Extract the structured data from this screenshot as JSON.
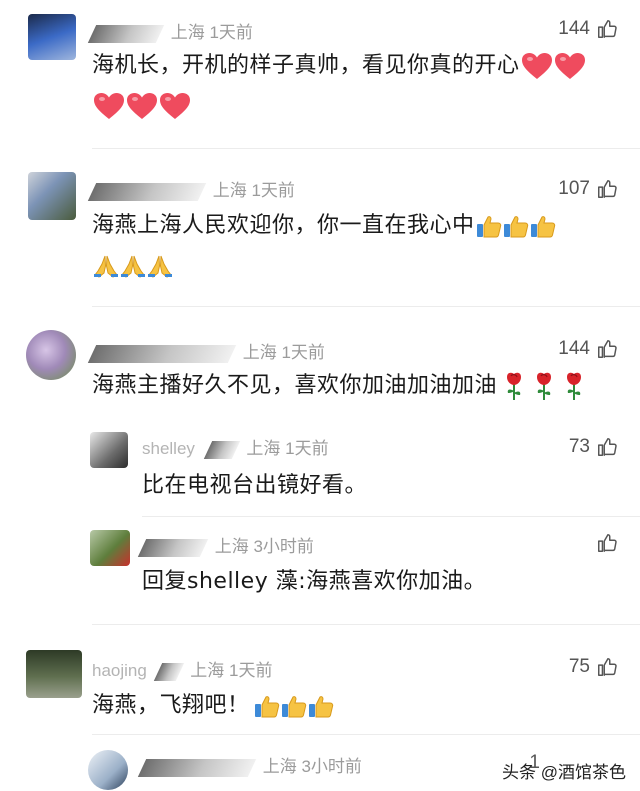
{
  "comments": [
    {
      "location": "上海",
      "time": "1天前",
      "likes": "144",
      "text": "海机长，开机的样子真帅，看见你真的开心",
      "emojis": [
        "heart",
        "heart",
        "heart",
        "heart",
        "heart"
      ]
    },
    {
      "location": "上海",
      "time": "1天前",
      "likes": "107",
      "text": "海燕上海人民欢迎你，你一直在我心中",
      "emojis": [
        "thumbs-up",
        "thumbs-up",
        "thumbs-up",
        "pray",
        "pray",
        "pray"
      ]
    },
    {
      "location": "上海",
      "time": "1天前",
      "likes": "144",
      "text": "海燕主播好久不见，喜欢你加油加油加油",
      "emojis": [
        "rose",
        "rose",
        "rose"
      ],
      "replies": [
        {
          "name_fragment": "shelley",
          "location": "上海",
          "time": "1天前",
          "likes": "73",
          "text": "比在电视台出镜好看。"
        },
        {
          "location": "上海",
          "time": "3小时前",
          "likes": "",
          "text": "回复shelley 藻:海燕喜欢你加油。"
        }
      ]
    },
    {
      "name_fragment": "haojing",
      "location": "上海",
      "time": "1天前",
      "likes": "75",
      "text": "海燕，飞翔吧！",
      "emojis": [
        "thumbs-up",
        "thumbs-up",
        "thumbs-up"
      ]
    },
    {
      "location": "上海",
      "time": "3小时前",
      "likes": "1"
    }
  ],
  "watermark": "头条 @酒馆茶色",
  "colors": {
    "meta_gray": "#9b9b9b",
    "heart_red": "#ef4b5e",
    "thumb_yellow": "#f6c343",
    "rose_red": "#d8232a"
  }
}
